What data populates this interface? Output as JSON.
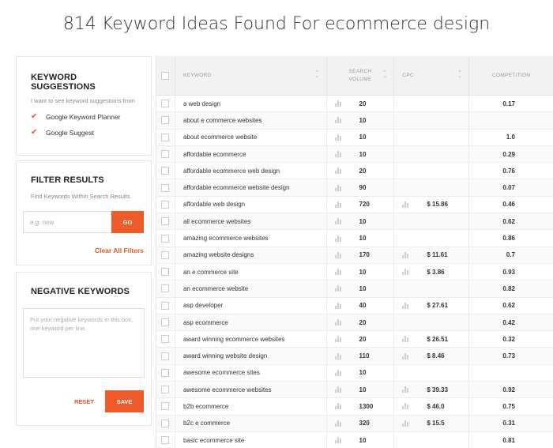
{
  "page": {
    "title": "814 Keyword Ideas Found For ecommerce design"
  },
  "keyword_suggestions": {
    "heading": "KEYWORD SUGGESTIONS",
    "subtext": "I want to see keyword suggestions from",
    "sources": [
      {
        "label": "Google Keyword Planner",
        "checked": true
      },
      {
        "label": "Google Suggest",
        "checked": true
      }
    ]
  },
  "filter": {
    "heading": "FILTER RESULTS",
    "subtext": "Find Keywords Within Search Results",
    "placeholder": "e.g. new",
    "go_label": "GO",
    "clear_label": "Clear All Filters"
  },
  "negative": {
    "heading": "NEGATIVE KEYWORDS",
    "placeholder": "Put your negative keywords in this box, one keyword per line.",
    "reset_label": "RESET",
    "save_label": "SAVE"
  },
  "table": {
    "headers": {
      "keyword": "KEYWORD",
      "volume_1": "SEARCH",
      "volume_2": "VOLUME",
      "cpc": "CPC",
      "competition": "COMPETITION"
    },
    "rows": [
      {
        "keyword": "a web design",
        "volume": "20",
        "cpc": "",
        "competition": "0.17"
      },
      {
        "keyword": "about e commerce websites",
        "volume": "10",
        "cpc": "",
        "competition": ""
      },
      {
        "keyword": "about ecommerce website",
        "volume": "10",
        "cpc": "",
        "competition": "1.0"
      },
      {
        "keyword": "affordable ecommerce",
        "volume": "10",
        "cpc": "",
        "competition": "0.29"
      },
      {
        "keyword": "affordable ecommerce web design",
        "volume": "20",
        "cpc": "",
        "competition": "0.76"
      },
      {
        "keyword": "affordable ecommerce website design",
        "volume": "90",
        "cpc": "",
        "competition": "0.07"
      },
      {
        "keyword": "affordable web design",
        "volume": "720",
        "cpc": "$ 15.86",
        "competition": "0.46"
      },
      {
        "keyword": "all ecommerce websites",
        "volume": "10",
        "cpc": "",
        "competition": "0.62"
      },
      {
        "keyword": "amazing ecommerce websites",
        "volume": "10",
        "cpc": "",
        "competition": "0.86"
      },
      {
        "keyword": "amazing website designs",
        "volume": "170",
        "cpc": "$ 11.61",
        "competition": "0.7"
      },
      {
        "keyword": "an e commerce site",
        "volume": "10",
        "cpc": "$ 3.86",
        "competition": "0.93"
      },
      {
        "keyword": "an ecommerce website",
        "volume": "10",
        "cpc": "",
        "competition": "0.82"
      },
      {
        "keyword": "asp developer",
        "volume": "40",
        "cpc": "$ 27.61",
        "competition": "0.62"
      },
      {
        "keyword": "asp ecommerce",
        "volume": "20",
        "cpc": "",
        "competition": "0.42"
      },
      {
        "keyword": "award winning ecommerce websites",
        "volume": "20",
        "cpc": "$ 26.51",
        "competition": "0.32"
      },
      {
        "keyword": "award winning website design",
        "volume": "110",
        "cpc": "$ 8.46",
        "competition": "0.73"
      },
      {
        "keyword": "awesome ecommerce sites",
        "volume": "10",
        "cpc": "",
        "competition": ""
      },
      {
        "keyword": "awesome ecommerce websites",
        "volume": "10",
        "cpc": "$ 39.33",
        "competition": "0.92"
      },
      {
        "keyword": "b2b ecommerce",
        "volume": "1300",
        "cpc": "$ 46.0",
        "competition": "0.75"
      },
      {
        "keyword": "b2c e commerce",
        "volume": "320",
        "cpc": "$ 15.5",
        "competition": "0.31"
      },
      {
        "keyword": "basic ecommerce site",
        "volume": "10",
        "cpc": "",
        "competition": "0.81"
      }
    ]
  },
  "colors": {
    "accent": "#ee5a2a",
    "header_bg": "#f3f3f3"
  },
  "icons": {
    "checkmark": "check-icon",
    "bars": "bar-chart-icon",
    "sort": "sort-arrows-icon"
  }
}
